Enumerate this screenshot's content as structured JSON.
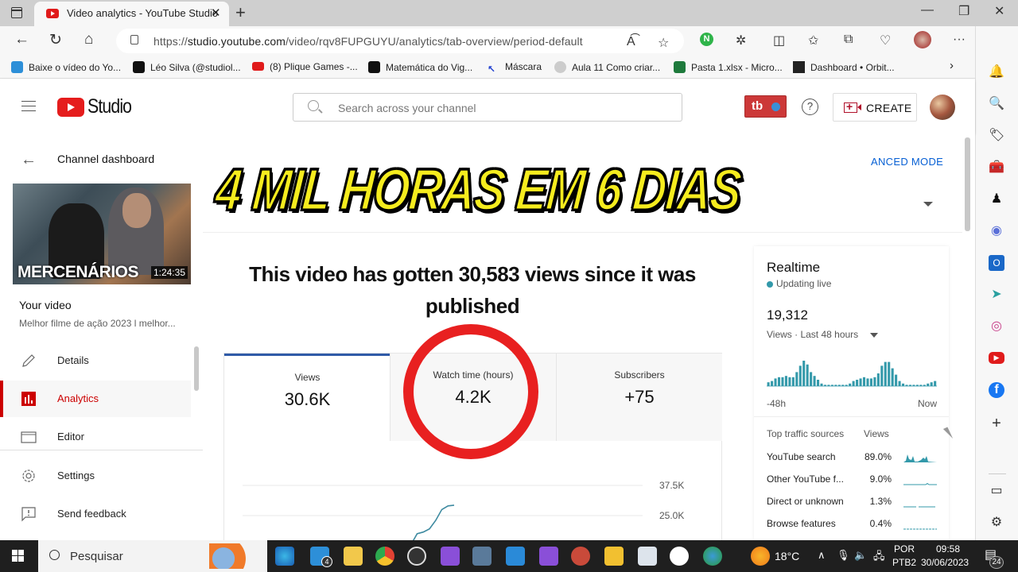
{
  "browser": {
    "tab_title": "Video analytics - YouTube Studio",
    "url_prefix": "https://",
    "url_host": "studio.youtube.com",
    "url_path": "/video/rqv8FUPGUYU/analytics/tab-overview/period-default",
    "bookmarks": [
      {
        "label": "Baixe o vídeo do Yo...",
        "icon": "download-icon",
        "color": "#2d8fd8"
      },
      {
        "label": "Léo Silva (@studiol...",
        "icon": "tiktok-icon",
        "color": "#111111"
      },
      {
        "label": "(8) Plique Games -...",
        "icon": "youtube-icon",
        "color": "#e01b1b"
      },
      {
        "label": "Matemática do Vig...",
        "icon": "tiktok-icon",
        "color": "#111111"
      },
      {
        "label": "Máscara",
        "icon": "arrow-icon",
        "color": "#1f3fcf"
      },
      {
        "label": "Aula 11 Como criar...",
        "icon": "apple-icon",
        "color": "#bbbbbb"
      },
      {
        "label": "Pasta 1.xlsx - Micro...",
        "icon": "excel-icon",
        "color": "#1e7a3c"
      },
      {
        "label": "Dashboard • Orbit...",
        "icon": "dashboard-icon",
        "color": "#222222"
      }
    ]
  },
  "studio": {
    "logo_text": "Studio",
    "search_placeholder": "Search across your channel",
    "tubebuddy_label": "tb",
    "create_label": "CREATE",
    "back_label": "Channel dashboard",
    "thumbnail_title": "MERCENÁRIOS",
    "thumbnail_duration": "1:24:35",
    "your_video_label": "Your video",
    "video_title": "Melhor filme de ação 2023 l melhor...",
    "nav": [
      {
        "label": "Details",
        "icon": "pencil-icon",
        "active": false
      },
      {
        "label": "Analytics",
        "icon": "analytics-icon",
        "active": true
      },
      {
        "label": "Editor",
        "icon": "clapper-icon",
        "active": false
      },
      {
        "label": "Settings",
        "icon": "gear-icon",
        "active": false
      },
      {
        "label": "Send feedback",
        "icon": "feedback-icon",
        "active": false
      }
    ],
    "advanced_mode_label": "ANCED MODE",
    "overlay_text": "4 MIL HORAS EM 6 DIAS",
    "headline": "This video has gotten 30,583 views since it was published",
    "metrics": [
      {
        "label": "Views",
        "value": "30.6K"
      },
      {
        "label": "Watch time (hours)",
        "value": "4.2K"
      },
      {
        "label": "Subscribers",
        "value": "+75"
      }
    ],
    "chart": {
      "y_ticks": [
        "37.5K",
        "25.0K"
      ],
      "y_tick_values": [
        37500,
        25000
      ],
      "line_color": "#3d8aa0",
      "cumulative_views_visible": [
        8000,
        13000,
        17500,
        18200,
        19500,
        23000,
        27500,
        29000,
        29300
      ]
    },
    "realtime": {
      "title": "Realtime",
      "status": "Updating live",
      "count": "19,312",
      "period_label": "Views · Last 48 hours",
      "x_start": "-48h",
      "x_end": "Now",
      "bar_color": "#3399aa",
      "hourly_bars": [
        3,
        4,
        6,
        7,
        7,
        8,
        7,
        7,
        11,
        16,
        20,
        17,
        11,
        8,
        5,
        2,
        1,
        1,
        1,
        1,
        1,
        1,
        1,
        2,
        4,
        5,
        6,
        7,
        6,
        6,
        7,
        10,
        16,
        19,
        19,
        14,
        9,
        4,
        2,
        1,
        1,
        1,
        1,
        1,
        1,
        2,
        3,
        4
      ],
      "traffic_head": "Top traffic sources",
      "traffic_views_head": "Views",
      "traffic_sources": [
        {
          "source": "YouTube search",
          "pct": "89.0%"
        },
        {
          "source": "Other YouTube f...",
          "pct": "9.0%"
        },
        {
          "source": "Direct or unknown",
          "pct": "1.3%"
        },
        {
          "source": "Browse features",
          "pct": "0.4%"
        }
      ]
    }
  },
  "taskbar": {
    "search_label": "Pesquisar",
    "weather": "18°C",
    "lang_top": "POR",
    "lang_bottom": "PTB2",
    "time": "09:58",
    "date": "30/06/2023",
    "mail_badge": "4",
    "notif_badge": "24"
  }
}
